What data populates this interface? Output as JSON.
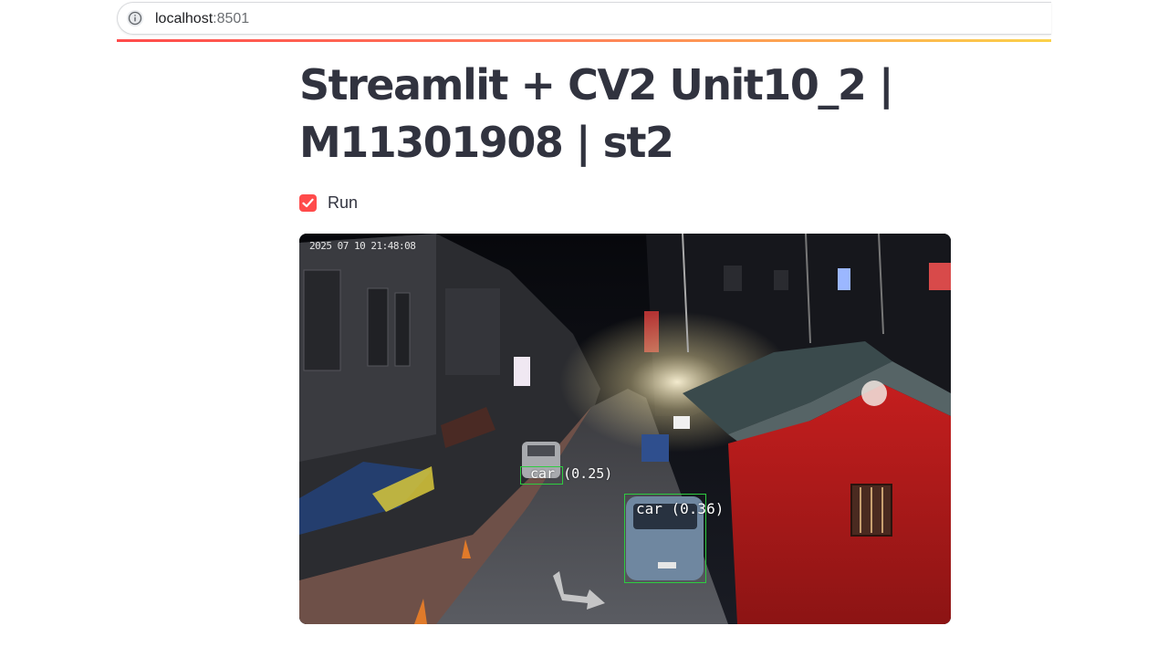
{
  "browser": {
    "url_host": "localhost",
    "url_port": ":8501",
    "info_icon": "info-icon"
  },
  "app": {
    "title_line1": "Streamlit + CV2 Unit10_2 |",
    "title_line2": "M11301908 | st2",
    "run_checkbox": {
      "label": "Run",
      "checked": true,
      "color": "#ff4b4b"
    }
  },
  "video": {
    "timestamp": "2025 07 10 21:48:08",
    "detections": [
      {
        "label": "car (0.25)"
      },
      {
        "label": "car (0.36)"
      }
    ],
    "box_color": "#2ecc40"
  },
  "colors": {
    "text": "#31333f",
    "accent": "#ff4b4b",
    "gradient_end": "#fbd14a"
  }
}
